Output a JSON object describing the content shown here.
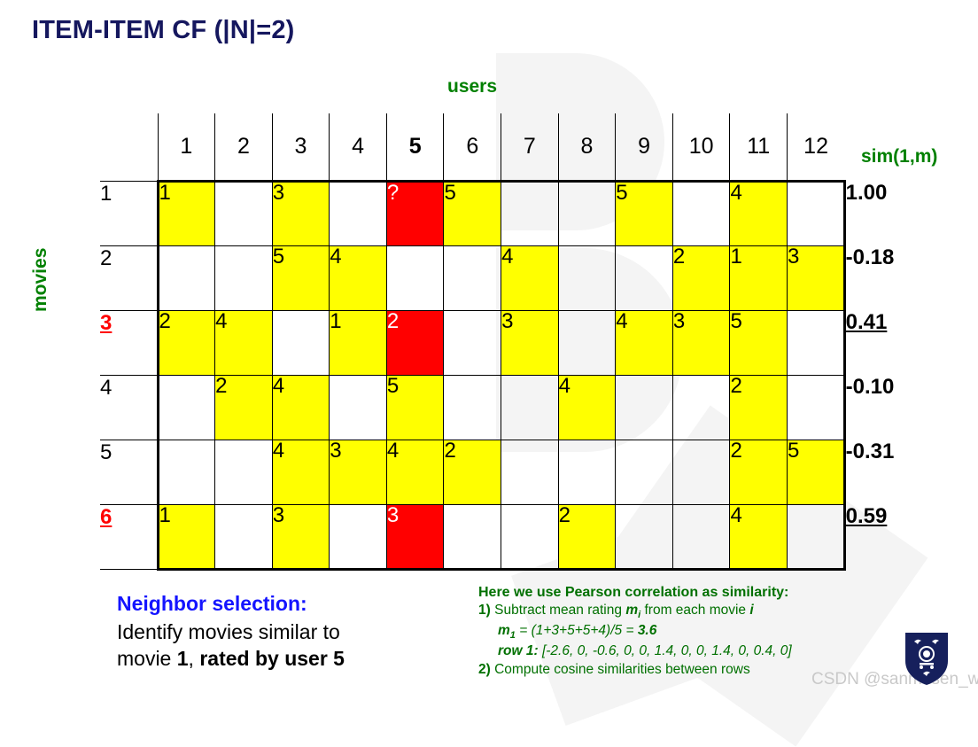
{
  "title": "ITEM-ITEM CF (|N|=2)",
  "axis_labels": {
    "columns": "users",
    "rows": "movies"
  },
  "sim_column": {
    "header": "sim(1,m)",
    "values": [
      "1.00",
      "-0.18",
      "0.41",
      "-0.10",
      "-0.31",
      "0.59"
    ],
    "highlighted": [
      false,
      false,
      true,
      false,
      false,
      true
    ],
    "color": "#008000"
  },
  "colors": {
    "title": "#15175e",
    "rated": "#ffff00",
    "target": "#ff0000",
    "green": "#008000",
    "blue": "#1414ff",
    "watermark": "#c9c9c9"
  },
  "chart_data": {
    "type": "table",
    "title": "ITEM-ITEM CF (|N|=2)",
    "xlabel": "users",
    "ylabel": "movies",
    "column_headers": [
      "1",
      "2",
      "3",
      "4",
      "5",
      "6",
      "7",
      "8",
      "9",
      "10",
      "11",
      "12"
    ],
    "bold_column_header": "5",
    "row_headers": [
      "1",
      "2",
      "3",
      "4",
      "5",
      "6"
    ],
    "highlighted_row_headers": [
      "3",
      "6"
    ],
    "rows": [
      {
        "label": "1",
        "cells": [
          {
            "value": "1",
            "state": "rated"
          },
          {
            "value": "",
            "state": "empty"
          },
          {
            "value": "3",
            "state": "rated"
          },
          {
            "value": "",
            "state": "empty"
          },
          {
            "value": "?",
            "state": "target"
          },
          {
            "value": "5",
            "state": "rated"
          },
          {
            "value": "",
            "state": "empty"
          },
          {
            "value": "",
            "state": "empty"
          },
          {
            "value": "5",
            "state": "rated"
          },
          {
            "value": "",
            "state": "empty"
          },
          {
            "value": "4",
            "state": "rated"
          },
          {
            "value": "",
            "state": "empty"
          }
        ]
      },
      {
        "label": "2",
        "cells": [
          {
            "value": "",
            "state": "empty"
          },
          {
            "value": "",
            "state": "empty"
          },
          {
            "value": "5",
            "state": "rated"
          },
          {
            "value": "4",
            "state": "rated"
          },
          {
            "value": "",
            "state": "empty"
          },
          {
            "value": "",
            "state": "empty"
          },
          {
            "value": "4",
            "state": "rated"
          },
          {
            "value": "",
            "state": "empty"
          },
          {
            "value": "",
            "state": "empty"
          },
          {
            "value": "2",
            "state": "rated"
          },
          {
            "value": "1",
            "state": "rated"
          },
          {
            "value": "3",
            "state": "rated"
          }
        ]
      },
      {
        "label": "3",
        "cells": [
          {
            "value": "2",
            "state": "rated"
          },
          {
            "value": "4",
            "state": "rated"
          },
          {
            "value": "",
            "state": "empty"
          },
          {
            "value": "1",
            "state": "rated"
          },
          {
            "value": "2",
            "state": "target"
          },
          {
            "value": "",
            "state": "empty"
          },
          {
            "value": "3",
            "state": "rated"
          },
          {
            "value": "",
            "state": "empty"
          },
          {
            "value": "4",
            "state": "rated"
          },
          {
            "value": "3",
            "state": "rated"
          },
          {
            "value": "5",
            "state": "rated"
          },
          {
            "value": "",
            "state": "empty"
          }
        ]
      },
      {
        "label": "4",
        "cells": [
          {
            "value": "",
            "state": "empty"
          },
          {
            "value": "2",
            "state": "rated"
          },
          {
            "value": "4",
            "state": "rated"
          },
          {
            "value": "",
            "state": "empty"
          },
          {
            "value": "5",
            "state": "rated"
          },
          {
            "value": "",
            "state": "empty"
          },
          {
            "value": "",
            "state": "empty"
          },
          {
            "value": "4",
            "state": "rated"
          },
          {
            "value": "",
            "state": "empty"
          },
          {
            "value": "",
            "state": "empty"
          },
          {
            "value": "2",
            "state": "rated"
          },
          {
            "value": "",
            "state": "empty"
          }
        ]
      },
      {
        "label": "5",
        "cells": [
          {
            "value": "",
            "state": "empty"
          },
          {
            "value": "",
            "state": "empty"
          },
          {
            "value": "4",
            "state": "rated"
          },
          {
            "value": "3",
            "state": "rated"
          },
          {
            "value": "4",
            "state": "rated"
          },
          {
            "value": "2",
            "state": "rated"
          },
          {
            "value": "",
            "state": "empty"
          },
          {
            "value": "",
            "state": "empty"
          },
          {
            "value": "",
            "state": "empty"
          },
          {
            "value": "",
            "state": "empty"
          },
          {
            "value": "2",
            "state": "rated"
          },
          {
            "value": "5",
            "state": "rated"
          }
        ]
      },
      {
        "label": "6",
        "cells": [
          {
            "value": "1",
            "state": "rated"
          },
          {
            "value": "",
            "state": "empty"
          },
          {
            "value": "3",
            "state": "rated"
          },
          {
            "value": "",
            "state": "empty"
          },
          {
            "value": "3",
            "state": "target"
          },
          {
            "value": "",
            "state": "empty"
          },
          {
            "value": "",
            "state": "empty"
          },
          {
            "value": "2",
            "state": "rated"
          },
          {
            "value": "",
            "state": "empty"
          },
          {
            "value": "",
            "state": "empty"
          },
          {
            "value": "4",
            "state": "rated"
          },
          {
            "value": "",
            "state": "empty"
          }
        ]
      }
    ],
    "similarities": [
      "1.00",
      "-0.18",
      "0.41",
      "-0.10",
      "-0.31",
      "0.59"
    ]
  },
  "neighbor": {
    "title": "Neighbor selection:",
    "line1_a": "Identify movies similar to",
    "line2_a": "movie ",
    "line2_b": "1",
    "line2_c": ", ",
    "line2_d": "rated by user 5"
  },
  "pearson": {
    "header": "Here we use Pearson correlation as similarity:",
    "step1_num": "1)",
    "step1_a": "Subtract mean rating ",
    "step1_m": "m",
    "step1_msub": "i",
    "step1_b": " from each movie ",
    "step1_i": "i",
    "m1_label": "m",
    "m1_sub": "1",
    "m1_expr": " = (1+3+5+5+4)/5 = ",
    "m1_value": "3.6",
    "row1_label": "row 1:",
    "row1_values": " [-2.6, 0, -0.6, 0, 0, 1.4, 0, 0, 1.4, 0, 0.4, 0]",
    "step2_num": "2)",
    "step2_text": "Compute cosine similarities between rows"
  },
  "watermark": "CSDN @sanmusen_wu"
}
